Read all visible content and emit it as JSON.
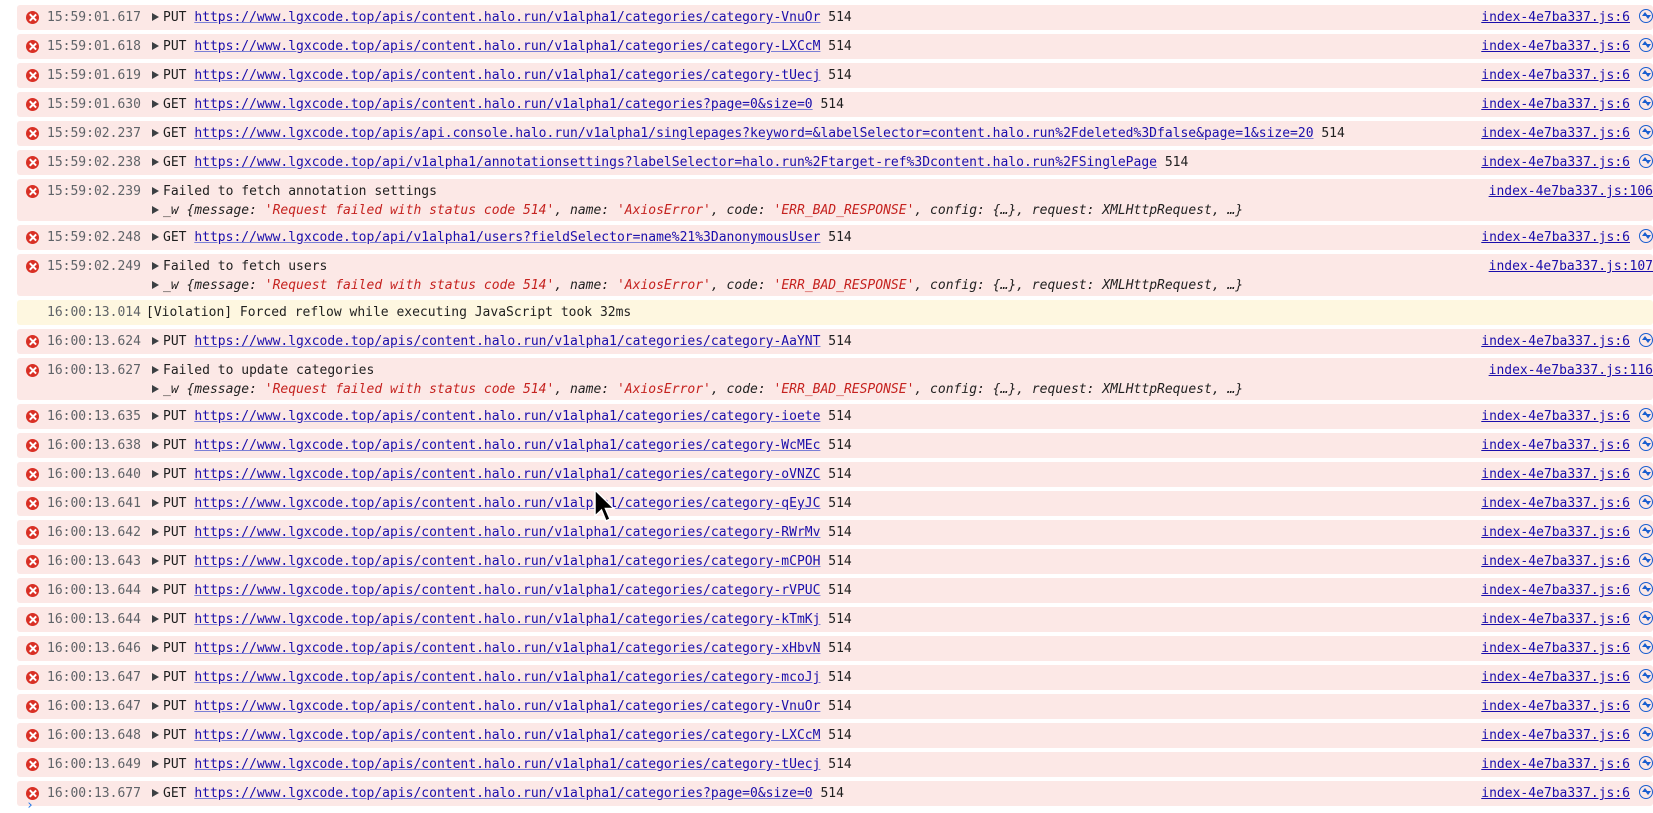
{
  "console": {
    "entries": [
      {
        "type": "request",
        "level": "error",
        "time": "15:59:01.617",
        "method": "PUT",
        "url": "https://www.lgxcode.top/apis/content.halo.run/v1alpha1/categories/category-VnuOr",
        "status": "514",
        "source": "index-4e7ba337.js:6"
      },
      {
        "type": "request",
        "level": "error",
        "time": "15:59:01.618",
        "method": "PUT",
        "url": "https://www.lgxcode.top/apis/content.halo.run/v1alpha1/categories/category-LXCcM",
        "status": "514",
        "source": "index-4e7ba337.js:6"
      },
      {
        "type": "request",
        "level": "error",
        "time": "15:59:01.619",
        "method": "PUT",
        "url": "https://www.lgxcode.top/apis/content.halo.run/v1alpha1/categories/category-tUecj",
        "status": "514",
        "source": "index-4e7ba337.js:6"
      },
      {
        "type": "request",
        "level": "error",
        "time": "15:59:01.630",
        "method": "GET",
        "url": "https://www.lgxcode.top/apis/content.halo.run/v1alpha1/categories?page=0&size=0",
        "status": "514",
        "source": "index-4e7ba337.js:6"
      },
      {
        "type": "request",
        "level": "error",
        "time": "15:59:02.237",
        "method": "GET",
        "url": "https://www.lgxcode.top/apis/api.console.halo.run/v1alpha1/singlepages?keyword=&labelSelector=content.halo.run%2Fdeleted%3Dfalse&page=1&size=20",
        "status": "514",
        "source": "index-4e7ba337.js:6"
      },
      {
        "type": "request",
        "level": "error",
        "time": "15:59:02.238",
        "method": "GET",
        "url": "https://www.lgxcode.top/api/v1alpha1/annotationsettings?labelSelector=halo.run%2Ftarget-ref%3Dcontent.halo.run%2FSinglePage",
        "status": "514",
        "source": "index-4e7ba337.js:6"
      },
      {
        "type": "error",
        "level": "error",
        "time": "15:59:02.239",
        "message": "Failed to fetch annotation settings",
        "obj_prefix": "_w {message: ",
        "obj_msg": "'Request failed with status code 514'",
        "obj_name_key": ", name: ",
        "obj_name": "'AxiosError'",
        "obj_code_key": ", code: ",
        "obj_code": "'ERR_BAD_RESPONSE'",
        "obj_rest": ", config: {…}, request: XMLHttpRequest, …}",
        "source": "index-4e7ba337.js:106"
      },
      {
        "type": "request",
        "level": "error",
        "time": "15:59:02.248",
        "method": "GET",
        "url": "https://www.lgxcode.top/api/v1alpha1/users?fieldSelector=name%21%3DanonymousUser",
        "status": "514",
        "source": "index-4e7ba337.js:6"
      },
      {
        "type": "error",
        "level": "error",
        "time": "15:59:02.249",
        "message": "Failed to fetch users",
        "obj_prefix": "_w {message: ",
        "obj_msg": "'Request failed with status code 514'",
        "obj_name_key": ", name: ",
        "obj_name": "'AxiosError'",
        "obj_code_key": ", code: ",
        "obj_code": "'ERR_BAD_RESPONSE'",
        "obj_rest": ", config: {…}, request: XMLHttpRequest, …}",
        "source": "index-4e7ba337.js:107"
      },
      {
        "type": "violation",
        "level": "warn",
        "time": "16:00:13.014",
        "message": "[Violation] Forced reflow while executing JavaScript took 32ms"
      },
      {
        "type": "request",
        "level": "error",
        "time": "16:00:13.624",
        "method": "PUT",
        "url": "https://www.lgxcode.top/apis/content.halo.run/v1alpha1/categories/category-AaYNT",
        "status": "514",
        "source": "index-4e7ba337.js:6"
      },
      {
        "type": "error",
        "level": "error",
        "time": "16:00:13.627",
        "message": "Failed to update categories",
        "obj_prefix": "_w {message: ",
        "obj_msg": "'Request failed with status code 514'",
        "obj_name_key": ", name: ",
        "obj_name": "'AxiosError'",
        "obj_code_key": ", code: ",
        "obj_code": "'ERR_BAD_RESPONSE'",
        "obj_rest": ", config: {…}, request: XMLHttpRequest, …}",
        "source": "index-4e7ba337.js:116"
      },
      {
        "type": "request",
        "level": "error",
        "time": "16:00:13.635",
        "method": "PUT",
        "url": "https://www.lgxcode.top/apis/content.halo.run/v1alpha1/categories/category-ioete",
        "status": "514",
        "source": "index-4e7ba337.js:6"
      },
      {
        "type": "request",
        "level": "error",
        "time": "16:00:13.638",
        "method": "PUT",
        "url": "https://www.lgxcode.top/apis/content.halo.run/v1alpha1/categories/category-WcMEc",
        "status": "514",
        "source": "index-4e7ba337.js:6"
      },
      {
        "type": "request",
        "level": "error",
        "time": "16:00:13.640",
        "method": "PUT",
        "url": "https://www.lgxcode.top/apis/content.halo.run/v1alpha1/categories/category-oVNZC",
        "status": "514",
        "source": "index-4e7ba337.js:6"
      },
      {
        "type": "request",
        "level": "error",
        "time": "16:00:13.641",
        "method": "PUT",
        "url": "https://www.lgxcode.top/apis/content.halo.run/v1alpha1/categories/category-qEyJC",
        "status": "514",
        "source": "index-4e7ba337.js:6"
      },
      {
        "type": "request",
        "level": "error",
        "time": "16:00:13.642",
        "method": "PUT",
        "url": "https://www.lgxcode.top/apis/content.halo.run/v1alpha1/categories/category-RWrMv",
        "status": "514",
        "source": "index-4e7ba337.js:6"
      },
      {
        "type": "request",
        "level": "error",
        "time": "16:00:13.643",
        "method": "PUT",
        "url": "https://www.lgxcode.top/apis/content.halo.run/v1alpha1/categories/category-mCPOH",
        "status": "514",
        "source": "index-4e7ba337.js:6"
      },
      {
        "type": "request",
        "level": "error",
        "time": "16:00:13.644",
        "method": "PUT",
        "url": "https://www.lgxcode.top/apis/content.halo.run/v1alpha1/categories/category-rVPUC",
        "status": "514",
        "source": "index-4e7ba337.js:6"
      },
      {
        "type": "request",
        "level": "error",
        "time": "16:00:13.644",
        "method": "PUT",
        "url": "https://www.lgxcode.top/apis/content.halo.run/v1alpha1/categories/category-kTmKj",
        "status": "514",
        "source": "index-4e7ba337.js:6"
      },
      {
        "type": "request",
        "level": "error",
        "time": "16:00:13.646",
        "method": "PUT",
        "url": "https://www.lgxcode.top/apis/content.halo.run/v1alpha1/categories/category-xHbvN",
        "status": "514",
        "source": "index-4e7ba337.js:6"
      },
      {
        "type": "request",
        "level": "error",
        "time": "16:00:13.647",
        "method": "PUT",
        "url": "https://www.lgxcode.top/apis/content.halo.run/v1alpha1/categories/category-mcoJj",
        "status": "514",
        "source": "index-4e7ba337.js:6"
      },
      {
        "type": "request",
        "level": "error",
        "time": "16:00:13.647",
        "method": "PUT",
        "url": "https://www.lgxcode.top/apis/content.halo.run/v1alpha1/categories/category-VnuOr",
        "status": "514",
        "source": "index-4e7ba337.js:6"
      },
      {
        "type": "request",
        "level": "error",
        "time": "16:00:13.648",
        "method": "PUT",
        "url": "https://www.lgxcode.top/apis/content.halo.run/v1alpha1/categories/category-LXCcM",
        "status": "514",
        "source": "index-4e7ba337.js:6"
      },
      {
        "type": "request",
        "level": "error",
        "time": "16:00:13.649",
        "method": "PUT",
        "url": "https://www.lgxcode.top/apis/content.halo.run/v1alpha1/categories/category-tUecj",
        "status": "514",
        "source": "index-4e7ba337.js:6"
      },
      {
        "type": "request",
        "level": "error",
        "time": "16:00:13.677",
        "method": "GET",
        "url": "https://www.lgxcode.top/apis/content.halo.run/v1alpha1/categories?page=0&size=0",
        "status": "514",
        "source": "index-4e7ba337.js:6"
      }
    ],
    "prompt_glyph": "›"
  },
  "icons": {
    "error": "error-circle-icon",
    "network": "network-request-icon",
    "expand": "expand-caret-icon",
    "cursor": "mouse-pointer-icon"
  },
  "colors": {
    "error_bg": "#fce8e6",
    "warn_bg": "#fef7e0",
    "error_icon": "#d93025",
    "link": "#1a0dab",
    "string": "#c5221f",
    "timestamp": "#5f6368"
  }
}
